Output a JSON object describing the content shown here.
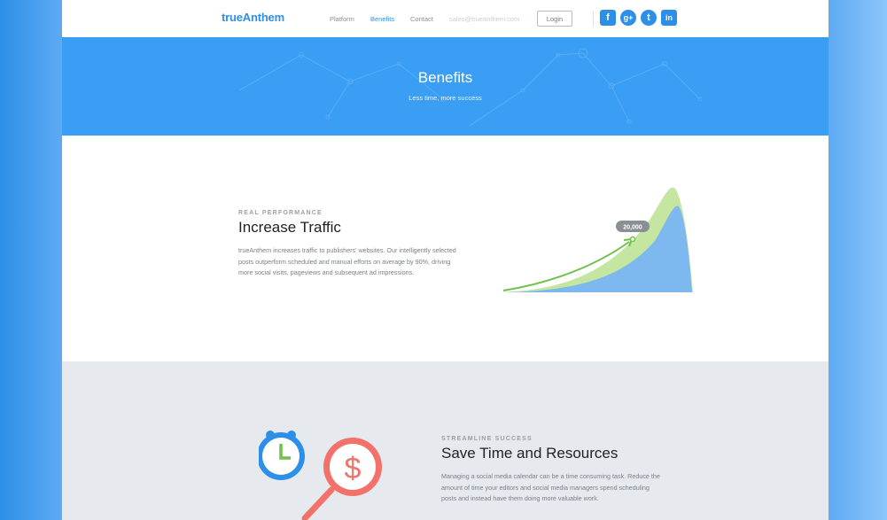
{
  "header": {
    "logo": "trueAnthem",
    "nav": [
      {
        "label": "Platform",
        "active": false
      },
      {
        "label": "Benefits",
        "active": true
      },
      {
        "label": "Contact",
        "active": false
      }
    ],
    "email": "sales@trueanthem.com",
    "login_label": "Login",
    "social": [
      {
        "name": "facebook-icon",
        "glyph": "f"
      },
      {
        "name": "google-plus-icon",
        "glyph": "g+"
      },
      {
        "name": "twitter-icon",
        "glyph": "t"
      },
      {
        "name": "linkedin-icon",
        "glyph": "in"
      }
    ]
  },
  "hero": {
    "title": "Benefits",
    "subtitle": "Less time, more success"
  },
  "section1": {
    "eyebrow": "REAL PERFORMANCE",
    "title": "Increase Traffic",
    "body": "trueAnthem increases traffic to publishers' websites. Our intelligently selected posts outperform scheduled and manual efforts on average by 90%, driving more social visits, pageviews and subsequent ad impressions.",
    "chart_label": "20,000"
  },
  "section2": {
    "eyebrow": "STREAMLINE SUCCESS",
    "title": "Save Time and Resources",
    "body": "Managing a social media calendar can be a time consuming task. Reduce the amount of time your editors and social media managers spend scheduling posts and instead have them doing more valuable work."
  },
  "colors": {
    "brand": "#2e8fe8",
    "hero_bg": "#3a9ef4",
    "chart_green": "#c5e6a0",
    "chart_blue": "#7db8ee",
    "arrow_green": "#6cc24a",
    "clock_blue": "#2e8fe8",
    "magnifier_red": "#f3716b",
    "section2_bg": "#e6e9ee"
  }
}
